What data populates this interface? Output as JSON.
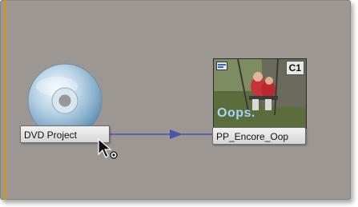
{
  "nodes": {
    "dvd_project": {
      "label": "DVD Project",
      "icon": "dvd-disc-icon"
    },
    "timeline": {
      "label": "PP_Encore_Oop",
      "badge": "C1",
      "overlay_text": "Oops.",
      "icon": "timeline-icon"
    }
  },
  "link": {
    "color": "#4656a9"
  },
  "colors": {
    "canvas": "#9d9793",
    "accent_edge": "#c7962f"
  },
  "cursor": {
    "icon": "link-cursor-icon"
  }
}
